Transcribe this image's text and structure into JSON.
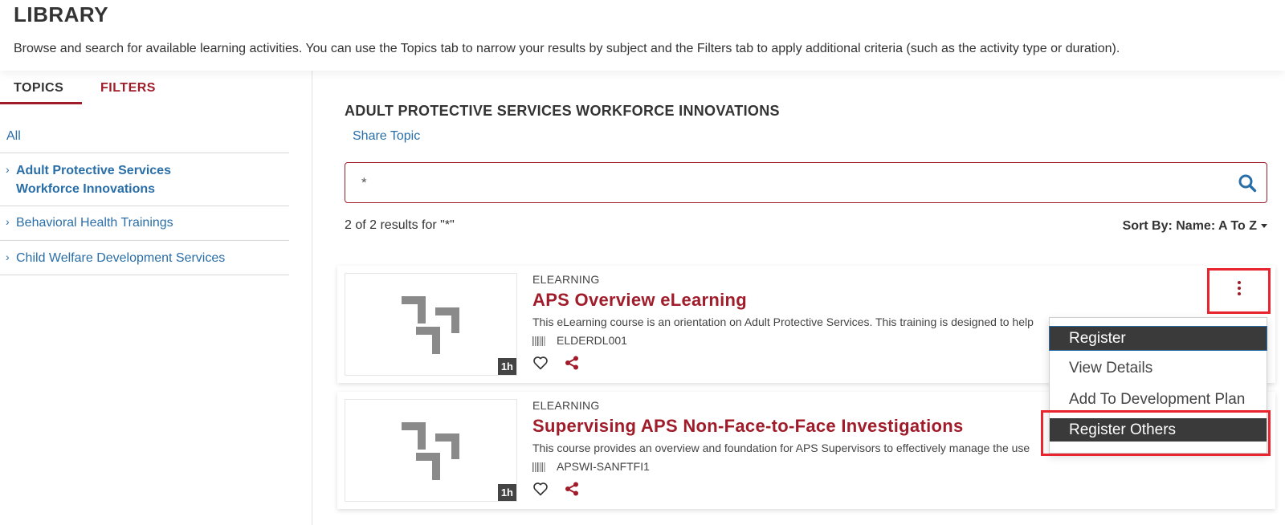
{
  "header": {
    "title": "LIBRARY",
    "description": "Browse and search for available learning activities. You can use the Topics tab to narrow your results by subject and the Filters tab to apply additional criteria (such as the activity type or duration)."
  },
  "sidebar": {
    "tabs": [
      {
        "label": "TOPICS",
        "active": true
      },
      {
        "label": "FILTERS",
        "active": false
      }
    ],
    "topics": [
      {
        "label": "All"
      },
      {
        "label": "Adult Protective Services Workforce Innovations",
        "selected": true
      },
      {
        "label": "Behavioral Health Trainings"
      },
      {
        "label": "Child Welfare Development Services"
      }
    ]
  },
  "main": {
    "topic_heading": "ADULT PROTECTIVE SERVICES WORKFORCE INNOVATIONS",
    "share_label": "Share Topic",
    "search": {
      "value": "*"
    },
    "results_count": "2 of 2 results for \"*\"",
    "sort_label": "Sort By: Name: A To Z",
    "cards": [
      {
        "type": "ELEARNING",
        "title": "APS Overview eLearning",
        "description": "This eLearning course is an orientation on Adult Protective Services. This training is designed to help",
        "code": "ELDERDL001",
        "duration": "1h"
      },
      {
        "type": "ELEARNING",
        "title": "Supervising APS Non-Face-to-Face Investigations",
        "description": "This course provides an overview and foundation for APS Supervisors to effectively manage the use",
        "code": "APSWI-SANFTFI1",
        "duration": "1h"
      }
    ]
  },
  "dropdown": {
    "items": [
      {
        "label": "Register"
      },
      {
        "label": "View Details"
      },
      {
        "label": "Add To Development Plan"
      },
      {
        "label": "Register Others"
      }
    ]
  },
  "colors": {
    "brand_red": "#a01c2a",
    "link_blue": "#2a6ea8",
    "highlight_red": "#e8252e"
  }
}
